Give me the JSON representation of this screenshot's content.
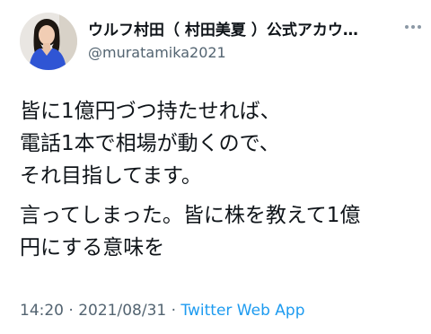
{
  "tweet": {
    "display_name": "ウルフ村田（ 村田美夏 ）公式アカウ…",
    "handle": "@muratamika2021",
    "paragraph1": "皆に1億円づつ持たせれば、\n電話1本で相場が動くので、\nそれ目指してます。",
    "paragraph2": "言ってしまった。皆に株を教えて1億\n円にする意味を",
    "time": "14:20",
    "separator1": " · ",
    "date": "2021/08/31",
    "separator2": " · ",
    "source": "Twitter Web App"
  },
  "icons": {
    "avatar": "profile-photo",
    "more": "more-options-icon"
  },
  "colors": {
    "text_primary": "#0f1419",
    "text_secondary": "#536471",
    "link": "#1d9bf0",
    "background": "#ffffff"
  }
}
